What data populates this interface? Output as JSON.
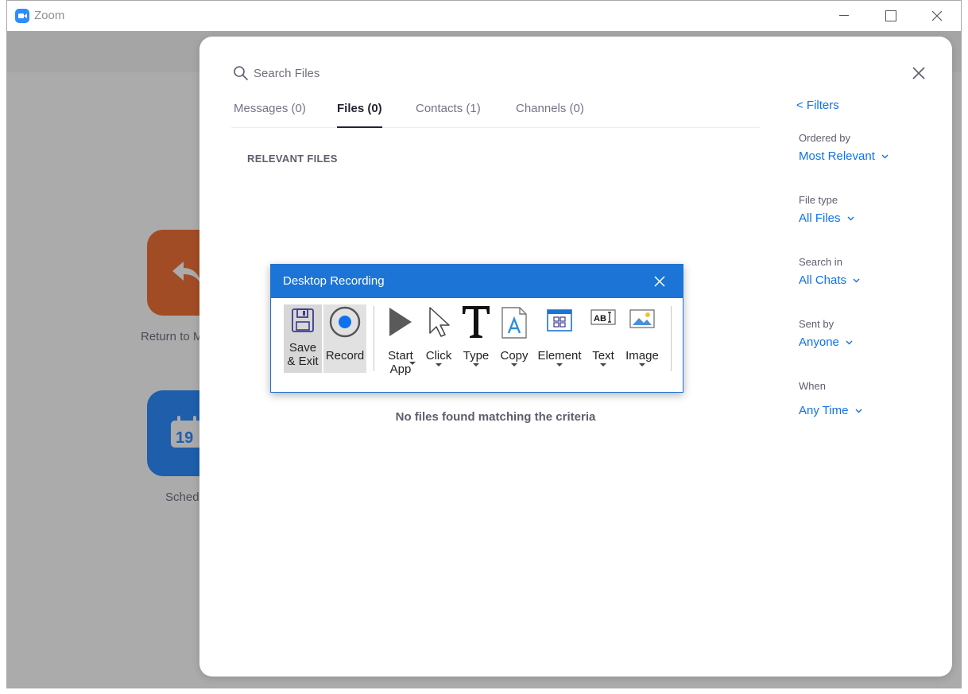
{
  "window": {
    "title": "Zoom"
  },
  "background": {
    "return_label": "Return to M",
    "schedule_label": "Sched",
    "calendar_number": "19"
  },
  "search": {
    "placeholder": "Search Files"
  },
  "tabs": [
    {
      "label": "Messages (0)"
    },
    {
      "label": "Files (0)"
    },
    {
      "label": "Contacts (1)"
    },
    {
      "label": "Channels (0)"
    }
  ],
  "section_heading": "RELEVANT FILES",
  "empty_message": "No files found matching the criteria",
  "filters": {
    "link": "< Filters",
    "items": [
      {
        "label": "Ordered by",
        "value": "Most Relevant"
      },
      {
        "label": "File type",
        "value": "All Files"
      },
      {
        "label": "Search in",
        "value": "All Chats"
      },
      {
        "label": "Sent by",
        "value": "Anyone"
      },
      {
        "label": "When",
        "value": "Any Time"
      }
    ]
  },
  "recording": {
    "title": "Desktop Recording",
    "tools": [
      {
        "label": "Save\n& Exit",
        "icon": "floppy-disk-icon"
      },
      {
        "label": "Record",
        "icon": "record-icon"
      },
      {
        "label": "Start\nApp",
        "icon": "play-icon"
      },
      {
        "label": "Click",
        "icon": "cursor-icon"
      },
      {
        "label": "Type",
        "icon": "type-icon"
      },
      {
        "label": "Copy",
        "icon": "copy-icon"
      },
      {
        "label": "Element",
        "icon": "element-icon"
      },
      {
        "label": "Text",
        "icon": "text-field-icon",
        "icon_text": "AB"
      },
      {
        "label": "Image",
        "icon": "image-icon"
      }
    ]
  },
  "colors": {
    "zoom_blue": "#2d8cff",
    "link_blue": "#0e72ed",
    "recorder_blue": "#1c75d6",
    "tile_orange": "#f27238"
  }
}
